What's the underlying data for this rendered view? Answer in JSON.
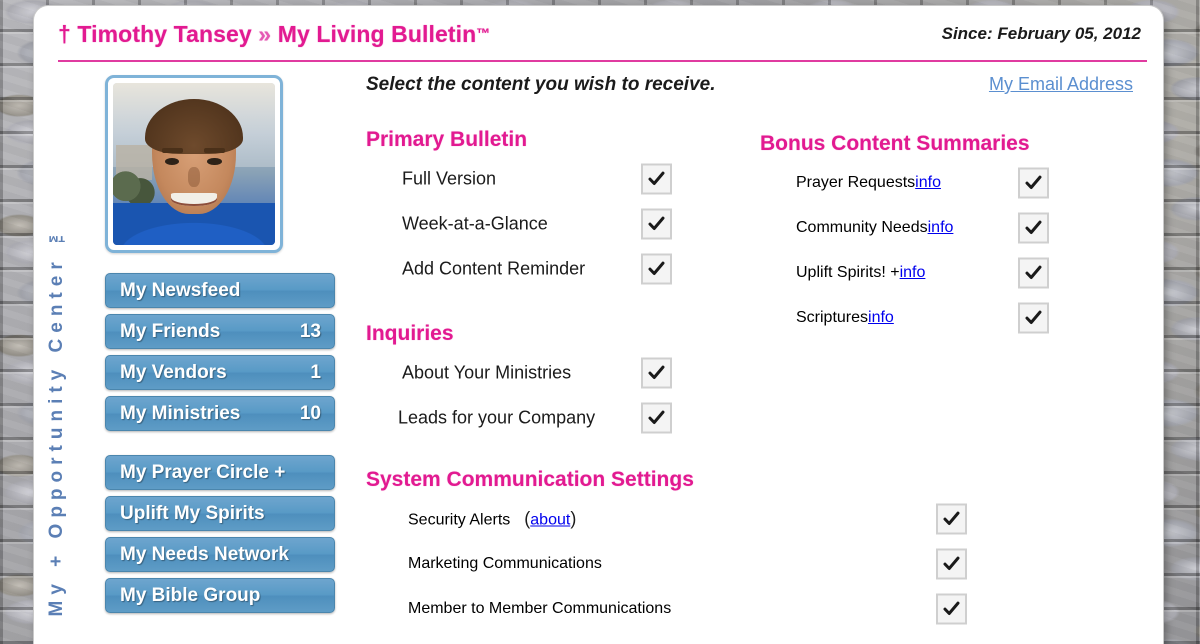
{
  "header": {
    "cross_symbol": "†",
    "user_name": "Timothy Tansey",
    "separator": "»",
    "product_name": "My Living Bulletin",
    "trademark": "™",
    "since_label": "Since: February 05, 2012",
    "brand_color": "#e21a91",
    "rule_color": "#e03ba0"
  },
  "sidebar": {
    "vertical_brand": "My + Opportunity Center ™",
    "vertical_brand_color": "#5b7fb5",
    "avatar_name": "profile-photo",
    "button_color": "#5b96c4",
    "groups": [
      {
        "name": "primary-nav",
        "items": [
          {
            "label": "My Newsfeed",
            "count": ""
          },
          {
            "label": "My Friends",
            "count": "13"
          },
          {
            "label": "My Vendors",
            "count": "1"
          },
          {
            "label": "My Ministries",
            "count": "10"
          }
        ]
      },
      {
        "name": "secondary-nav",
        "items": [
          {
            "label": "My Prayer Circle +",
            "count": ""
          },
          {
            "label": "Uplift My Spirits",
            "count": ""
          },
          {
            "label": "My Needs Network",
            "count": ""
          },
          {
            "label": "My Bible Group",
            "count": ""
          }
        ]
      }
    ]
  },
  "main": {
    "instruction": "Select the content you wish to receive.",
    "email_link": "My Email Address",
    "link_color": "#5b8fd0",
    "primary_bulletin": {
      "heading": "Primary Bulletin",
      "options": [
        {
          "label": "Full Version",
          "checked": true
        },
        {
          "label": "Week-at-a-Glance",
          "checked": true
        },
        {
          "label": "Add Content Reminder",
          "checked": true
        }
      ]
    },
    "inquiries": {
      "heading": "Inquiries",
      "options": [
        {
          "label": "About Your Ministries",
          "checked": true
        },
        {
          "label": "Leads for your Company",
          "checked": true
        }
      ]
    },
    "bonus_content": {
      "heading": "Bonus Content Summaries",
      "options": [
        {
          "label": "Prayer Requests",
          "link": "info",
          "checked": true
        },
        {
          "label": "Community Needs",
          "link": "info",
          "checked": true
        },
        {
          "label": "Uplift Spirits! +",
          "link": "info",
          "checked": true
        },
        {
          "label": "Scriptures",
          "link": "info",
          "checked": true
        }
      ]
    },
    "system_communication": {
      "heading": "System Communication Settings",
      "options": [
        {
          "label": "Security Alerts",
          "paren_open": "(",
          "link": "about",
          "paren_close": ")",
          "checked": true
        },
        {
          "label": "Marketing Communications",
          "paren_open": "",
          "link": "",
          "paren_close": "",
          "checked": true
        },
        {
          "label": "Member to Member Communications",
          "paren_open": "",
          "link": "",
          "paren_close": "",
          "checked": true
        }
      ]
    }
  }
}
